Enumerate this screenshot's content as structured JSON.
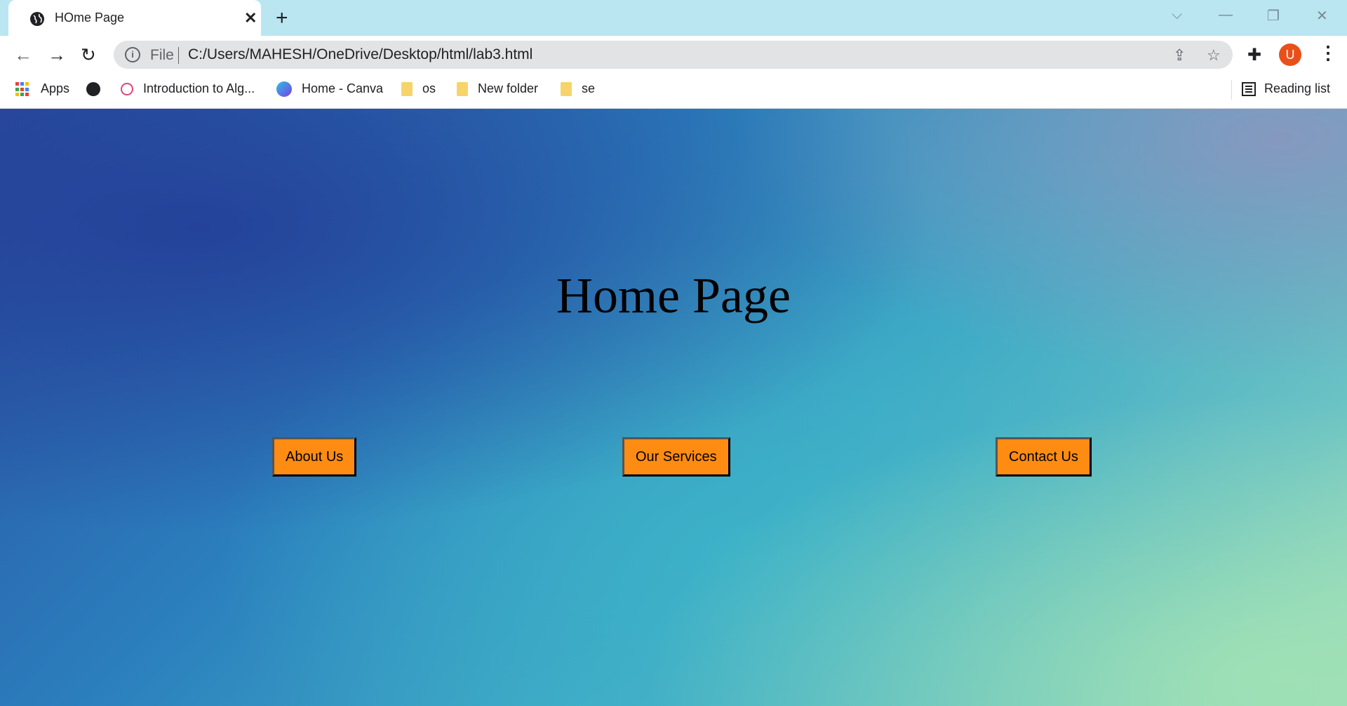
{
  "tab": {
    "title": "HOme Page",
    "close": "✕",
    "new_tab": "+"
  },
  "window_controls": {
    "dropdown": "⌵",
    "minimize": "—",
    "restore": "❐",
    "close": "✕"
  },
  "toolbar": {
    "back": "←",
    "forward": "→",
    "reload": "↻",
    "info_icon": "i",
    "file_label": "File",
    "url": "C:/Users/MAHESH/OneDrive/Desktop/html/lab3.html",
    "share_icon": "⇪",
    "star_icon": "☆",
    "extensions_icon": "✚",
    "avatar_letter": "U",
    "menu": "⋮"
  },
  "bookmarks": {
    "apps": "Apps",
    "items": [
      {
        "label": "Introduction to Alg...",
        "icon": "algorithms-favicon"
      },
      {
        "label": "Home - Canva",
        "icon": "canva-favicon"
      },
      {
        "label": "os",
        "icon": "folder-icon"
      },
      {
        "label": "New folder",
        "icon": "folder-icon"
      },
      {
        "label": "se",
        "icon": "folder-icon"
      }
    ],
    "reading_list": "Reading list"
  },
  "page": {
    "heading": "Home Page",
    "buttons": [
      "About Us",
      "Our Services",
      "Contact Us"
    ]
  },
  "colors": {
    "button_bg": "#ff8c12",
    "tab_strip": "#b9e6f0",
    "avatar": "#e8501a"
  }
}
